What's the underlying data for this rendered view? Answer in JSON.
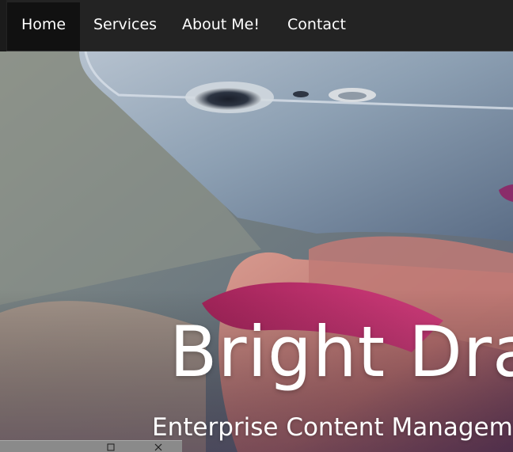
{
  "nav": {
    "items": [
      {
        "label": "Home",
        "active": true
      },
      {
        "label": "Services",
        "active": false
      },
      {
        "label": "About Me!",
        "active": false
      },
      {
        "label": "Contact",
        "active": false
      }
    ]
  },
  "hero": {
    "title": "Bright Dra",
    "subtitle": "Enterprise Content Managem",
    "background_image": "hand-holding-smartphone-photo"
  },
  "overlay_bar": {
    "maximize_icon": "maximize-icon",
    "close_icon": "close-icon"
  },
  "colors": {
    "nav_background": "#232323",
    "nav_active": "#111111",
    "text": "#ffffff",
    "overlay_bar": "#8a8a8a"
  }
}
